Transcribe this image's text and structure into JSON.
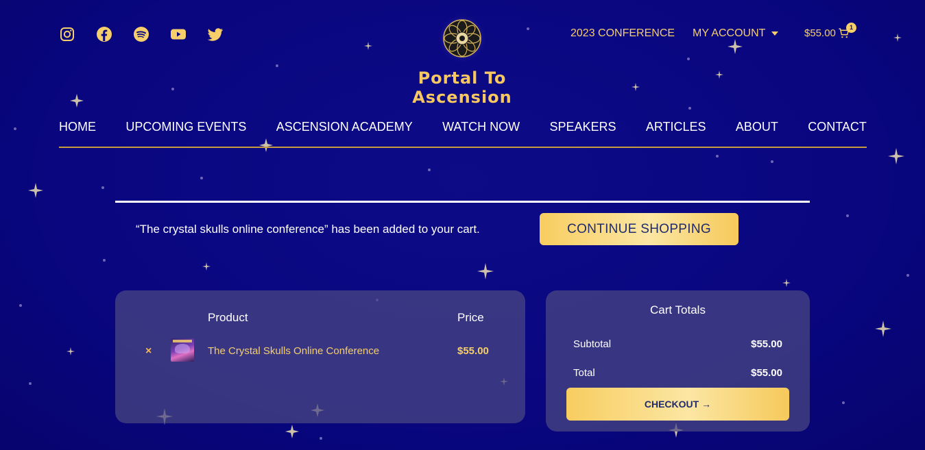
{
  "header": {
    "social": [
      {
        "name": "instagram-icon"
      },
      {
        "name": "facebook-icon"
      },
      {
        "name": "spotify-icon"
      },
      {
        "name": "youtube-icon"
      },
      {
        "name": "twitter-icon"
      }
    ],
    "brand": "Portal To Ascension",
    "conference_link": "2023 CONFERENCE",
    "account_link": "MY ACCOUNT",
    "cart_total": "$55.00",
    "cart_count": "1"
  },
  "nav": {
    "items": [
      "HOME",
      "UPCOMING EVENTS",
      "ASCENSION ACADEMY",
      "WATCH NOW",
      "SPEAKERS",
      "ARTICLES",
      "ABOUT",
      "CONTACT"
    ]
  },
  "notice": {
    "message": "“The crystal skulls online conference” has been added to your cart.",
    "continue_label": "CONTINUE SHOPPING"
  },
  "cart_table": {
    "headers": {
      "product": "Product",
      "price": "Price"
    },
    "rows": [
      {
        "remove": "×",
        "product": "The Crystal Skulls Online Conference",
        "price": "$55.00"
      }
    ]
  },
  "totals": {
    "title": "Cart Totals",
    "subtotal_label": "Subtotal",
    "subtotal_value": "$55.00",
    "total_label": "Total",
    "total_value": "$55.00",
    "checkout_label": "CHECKOUT →"
  },
  "colors": {
    "accent": "#f6cf6a",
    "background": "#0a0880",
    "panel": "#4b4882",
    "rule": "#c79c3f"
  }
}
